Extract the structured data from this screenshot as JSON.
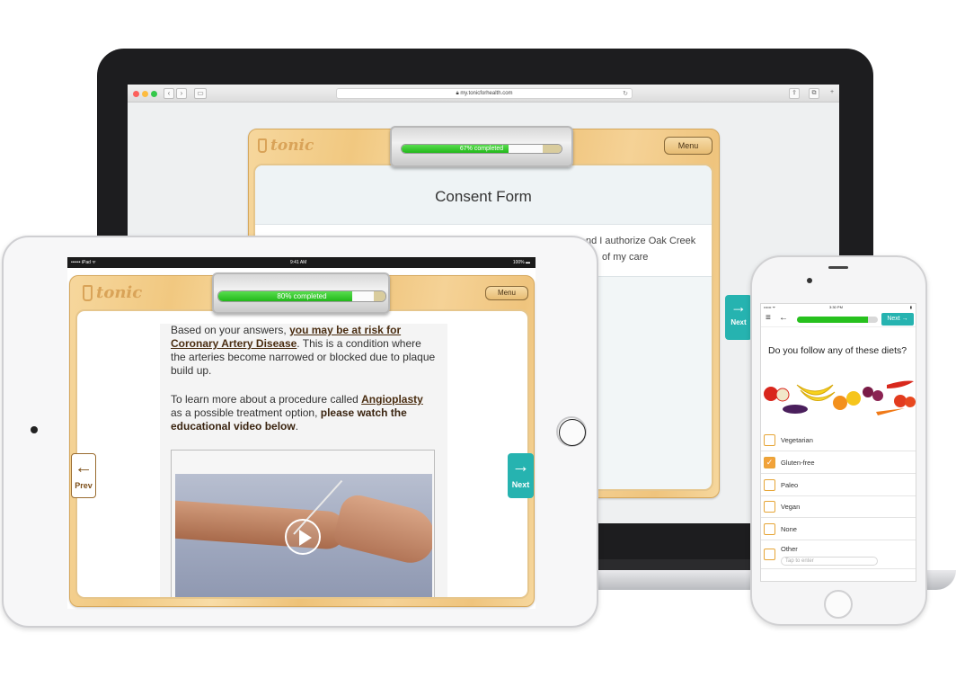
{
  "laptop": {
    "url": "my.tonicforhealth.com",
    "logo": "tonic",
    "menu_label": "Menu",
    "progress": {
      "percent": 67,
      "label": "67% completed"
    },
    "form_title": "Consent Form",
    "consent_line_1": "nd I authorize Oak Creek",
    "consent_line_2": "of my care",
    "next_label": "Next"
  },
  "tablet": {
    "status": {
      "left": "•••••• iPad ᯤ",
      "time": "9:41 AM",
      "battery": "100% ▬"
    },
    "logo": "tonic",
    "menu_label": "Menu",
    "progress": {
      "percent": 80,
      "label": "80% completed"
    },
    "para1": {
      "a": "Based on your answers, ",
      "b": "you may be at risk for Coronary Artery Disease",
      "c": ". This is a condition where the arteries become narrowed or blocked due to plaque build up."
    },
    "para2": {
      "a": "To learn more about a procedure called ",
      "b": "Angioplasty",
      "c": " as a possible treatment option, ",
      "d": "please watch the educational video below",
      "e": "."
    },
    "prev_label": "Prev",
    "next_label": "Next"
  },
  "phone": {
    "status": {
      "left": "•••••• ᯤ",
      "time": "3:30 PM",
      "battery": "▮"
    },
    "progress": {
      "percent": 88
    },
    "next_label": "Next",
    "question": "Do you follow any of these diets?",
    "options": [
      {
        "label": "Vegetarian",
        "checked": false
      },
      {
        "label": "Gluten-free",
        "checked": true
      },
      {
        "label": "Paleo",
        "checked": false
      },
      {
        "label": "Vegan",
        "checked": false
      },
      {
        "label": "None",
        "checked": false
      },
      {
        "label": "Other",
        "checked": false
      }
    ],
    "other_placeholder": "Tap to enter"
  },
  "colors": {
    "teal": "#26b3b0",
    "green": "#27c11e",
    "orange": "#f2a23a",
    "wood": "#f1c880"
  }
}
